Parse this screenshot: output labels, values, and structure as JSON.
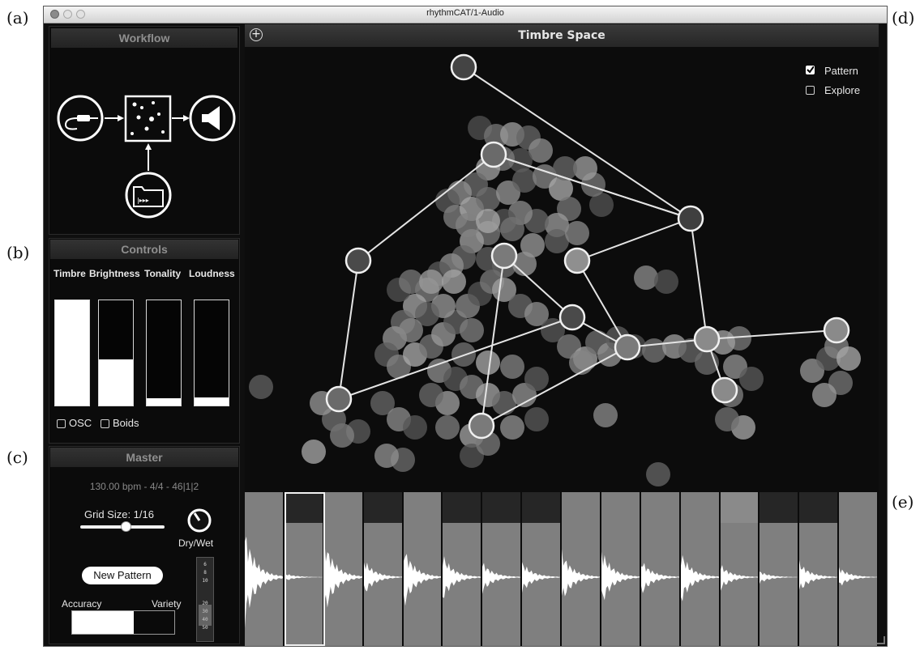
{
  "figure_labels": [
    "(a)",
    "(b)",
    "(c)",
    "(d)",
    "(e)"
  ],
  "window": {
    "title": "rhythmCAT/1-Audio"
  },
  "workflow": {
    "title": "Workflow"
  },
  "controls": {
    "title": "Controls",
    "params": [
      {
        "label": "Timbre",
        "level": 1.0
      },
      {
        "label": "Brightness",
        "level": 0.44
      },
      {
        "label": "Tonality",
        "level": 0.07
      },
      {
        "label": "Loudness",
        "level": 0.08
      }
    ],
    "checkboxes": [
      {
        "label": "OSC",
        "checked": false
      },
      {
        "label": "Boids",
        "checked": false
      }
    ]
  },
  "master": {
    "title": "Master",
    "transport": "130.00 bpm - 4/4  -  46|1|2",
    "grid_size_label": "Grid Size: 1/16",
    "grid_slider_value": 0.55,
    "dry_wet_label": "Dry/Wet",
    "new_pattern_label": "New Pattern",
    "accuracy_label": "Accuracy",
    "variety_label": "Variety",
    "accuracy_variety_value": 0.6,
    "meter_ticks": [
      "6",
      "8",
      "10",
      "20",
      "30",
      "40",
      "50"
    ]
  },
  "timbre_space": {
    "title": "Timbre Space",
    "options": [
      {
        "label": "Pattern",
        "checked": true
      },
      {
        "label": "Explore",
        "checked": false
      }
    ]
  },
  "waveform_strip": {
    "slice_count": 16,
    "selected_index": 1,
    "tints": [
      "#7f7f7f",
      "#262626",
      "#7f7f7f",
      "#262626",
      "#7f7f7f",
      "#262626",
      "#262626",
      "#262626",
      "#7f7f7f",
      "#7f7f7f",
      "#7f7f7f",
      "#7f7f7f",
      "#8a8a8a",
      "#262626",
      "#262626",
      "#7f7f7f"
    ],
    "amplitudes": [
      0.9,
      0.08,
      0.75,
      0.35,
      0.6,
      0.45,
      0.3,
      0.3,
      0.5,
      0.55,
      0.35,
      0.5,
      0.25,
      0.12,
      0.3,
      0.2
    ]
  },
  "colors": {
    "background": "#0c0c0c",
    "accent": "#ffffff",
    "panel_header": "#2b2b2b"
  }
}
